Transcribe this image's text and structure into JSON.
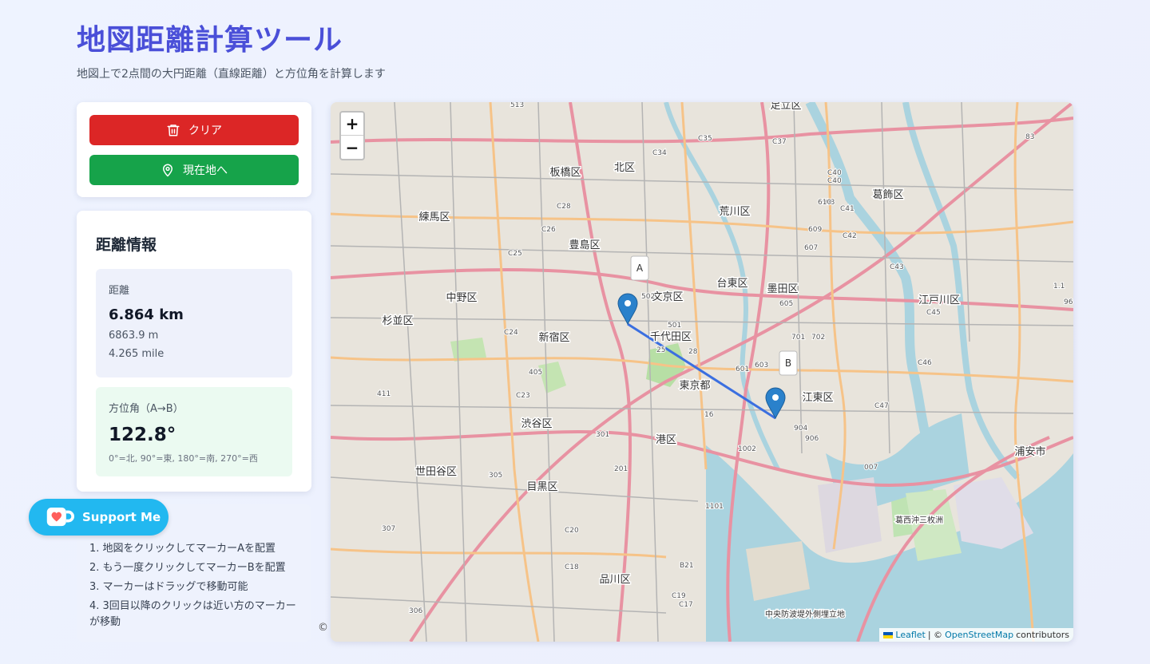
{
  "header": {
    "title": "地図距離計算ツール",
    "subtitle": "地図上で2点間の大円距離（直線距離）と方位角を計算します"
  },
  "controls": {
    "clear_label": "クリア",
    "locate_label": "現在地へ",
    "clear_color": "#dc2626",
    "locate_color": "#16a34a"
  },
  "info": {
    "title": "距離情報",
    "distance_label": "距離",
    "distance_km": "6.864 km",
    "distance_m": "6863.9 m",
    "distance_mile": "4.265 mile",
    "bearing_label": "方位角（A→B）",
    "bearing_value": "122.8°",
    "bearing_note": "0°=北, 90°=東, 180°=南, 270°=西"
  },
  "help": {
    "steps": [
      "1. 地図をクリックしてマーカーAを配置",
      "2. もう一度クリックしてマーカーBを配置",
      "3. マーカーはドラッグで移動可能",
      "4. 3回目以降のクリックは近い方のマーカーが移動"
    ]
  },
  "support": {
    "label": "Support Me"
  },
  "map": {
    "zoom_in": "+",
    "zoom_out": "−",
    "marker_a": "A",
    "marker_b": "B",
    "route_color": "#3b6fe0",
    "marker_color": "#2a81cb",
    "attribution": {
      "leaflet": "Leaflet",
      "sep": "| ©",
      "osm": "OpenStreetMap",
      "suffix": "contributors"
    },
    "districts": [
      "足立区",
      "北区",
      "板橋区",
      "荒川区",
      "葛飾区",
      "練馬区",
      "豊島区",
      "文京区",
      "台東区",
      "墨田区",
      "中野区",
      "江戸川区",
      "杉並区",
      "新宿区",
      "千代田区",
      "江東区",
      "東京都",
      "渋谷区",
      "港区",
      "世田谷区",
      "浦安市",
      "目黒区",
      "品川区",
      "中央防波堤外側埋立地",
      "葛西沖三枚洲"
    ],
    "road_labels": [
      "513",
      "C35",
      "C37",
      "C34",
      "C40",
      "C40",
      "C41",
      "C42",
      "C43",
      "C45",
      "C46",
      "C47",
      "C28",
      "C26",
      "C25",
      "C24",
      "C23",
      "C20",
      "C18",
      "C19",
      "C17",
      "B21",
      "305",
      "307",
      "306",
      "608",
      "610",
      "609",
      "607",
      "605",
      "501",
      "502",
      "701",
      "702",
      "603",
      "601",
      "904",
      "906",
      "1002",
      "1101",
      "007",
      "405",
      "411",
      "25",
      "28",
      "16",
      "301",
      "201",
      "83",
      "1.1",
      "96"
    ],
    "copyright_mark": "©"
  }
}
